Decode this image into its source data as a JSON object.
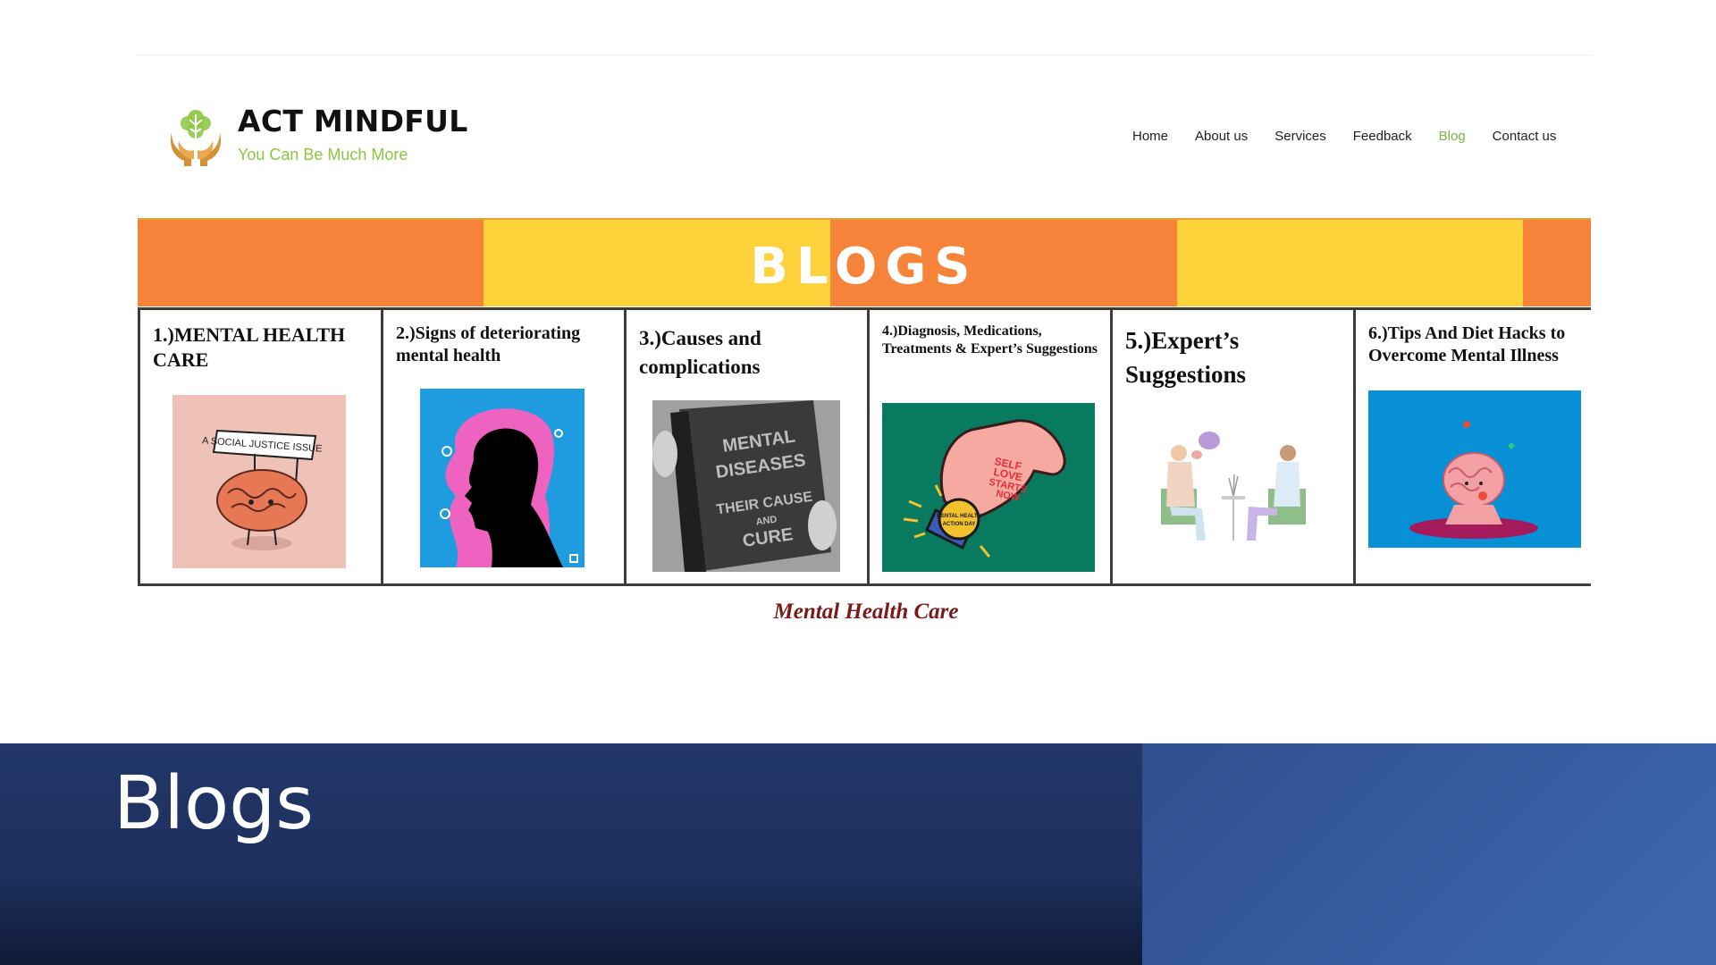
{
  "brand": {
    "title": "ACT MINDFUL",
    "tagline": "You Can Be Much More"
  },
  "nav": {
    "items": [
      {
        "label": "Home",
        "active": false
      },
      {
        "label": "About us",
        "active": false
      },
      {
        "label": "Services",
        "active": false
      },
      {
        "label": "Feedback",
        "active": false
      },
      {
        "label": "Blog",
        "active": true
      },
      {
        "label": "Contact us",
        "active": false
      }
    ]
  },
  "banner": {
    "title": "BLOGS",
    "colors": [
      "#f5833a",
      "#fdd23b"
    ]
  },
  "cards": [
    {
      "title": "1.)MENTAL HEALTH CARE",
      "image": "brain-with-social-justice-sign"
    },
    {
      "title": "2.)Signs of deteriorating mental health",
      "image": "head-silhouette"
    },
    {
      "title": "3.)Causes and complications",
      "image": "mental-diseases-book",
      "book_text": "MENTAL DISEASES THEIR CAUSE AND CURE"
    },
    {
      "title": "4.)Diagnosis, Medications, Treatments & Expert’s Suggestions",
      "image": "self-love-hand-watch",
      "hand_text": "SELF LOVE STARTS NOW",
      "watch_text": "MENTAL HEALTH ACTION DAY"
    },
    {
      "title": "5.)Expert’s Suggestions",
      "image": "two-women-talking"
    },
    {
      "title": "6.)Tips And Diet Hacks to Overcome Mental Illness",
      "image": "meditating-brain"
    }
  ],
  "image_sign": {
    "text": "A SOCIAL JUSTICE ISSUE"
  },
  "caption": "Mental Health Care",
  "slide": {
    "title": "Blogs"
  }
}
